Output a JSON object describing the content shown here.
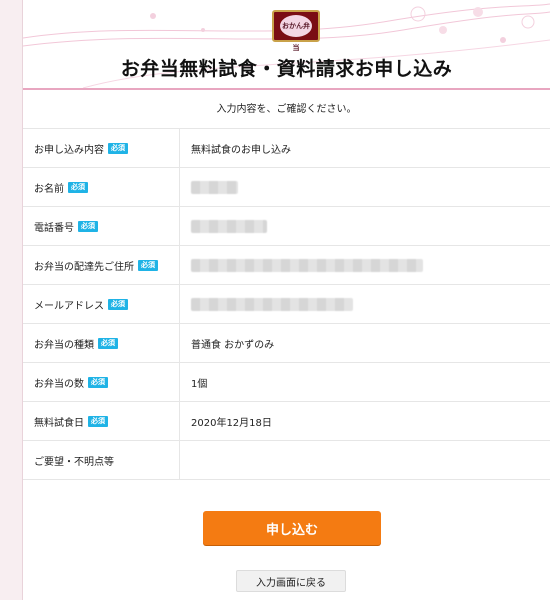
{
  "header": {
    "title": "お弁当無料試食・資料請求お申し込み",
    "logo_text": "おかん弁当"
  },
  "subtitle": "入力内容を、ご確認ください。",
  "required_badge": "必須",
  "rows": [
    {
      "label": "お申し込み内容",
      "required": true,
      "value": "無料試食のお申し込み"
    },
    {
      "label": "お名前",
      "required": true,
      "value": ""
    },
    {
      "label": "電話番号",
      "required": true,
      "value": ""
    },
    {
      "label": "お弁当の配達先ご住所",
      "required": true,
      "value": ""
    },
    {
      "label": "メールアドレス",
      "required": true,
      "value": ""
    },
    {
      "label": "お弁当の種類",
      "required": true,
      "value": "普通食 おかずのみ"
    },
    {
      "label": "お弁当の数",
      "required": true,
      "value": "1個"
    },
    {
      "label": "無料試食日",
      "required": true,
      "value": "2020年12月18日"
    },
    {
      "label": "ご要望・不明点等",
      "required": false,
      "value": ""
    }
  ],
  "buttons": {
    "submit": "申し込む",
    "back": "入力画面に戻る"
  },
  "colors": {
    "accent": "#f47b12",
    "badge": "#1fb3e6",
    "pink": "#e8a6c0"
  }
}
